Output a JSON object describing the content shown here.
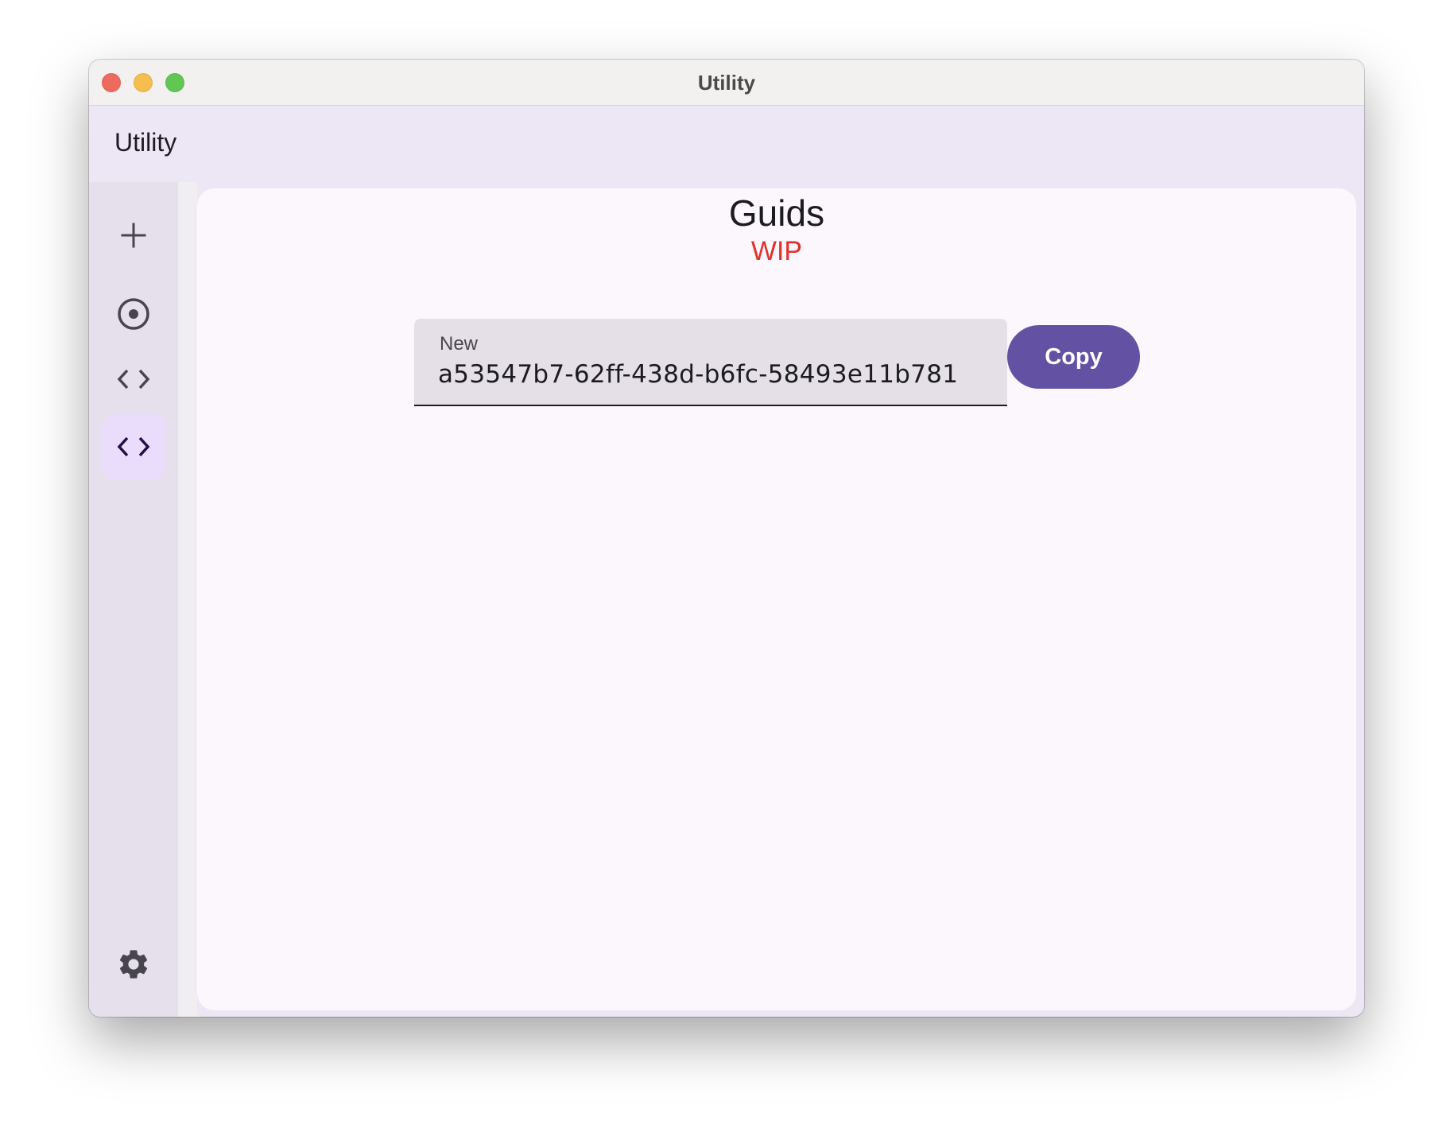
{
  "window": {
    "title": "Utility"
  },
  "appbar": {
    "title": "Utility"
  },
  "rail": {
    "items": [
      {
        "icon": "add-icon",
        "active": false
      },
      {
        "icon": "radio-button-icon",
        "active": false
      },
      {
        "icon": "code-icon",
        "active": false
      },
      {
        "icon": "code-icon",
        "active": true
      }
    ],
    "footer_icon": "gear-icon"
  },
  "main": {
    "title": "Guids",
    "subtitle": "WIP",
    "guid_field": {
      "label": "New",
      "value": "a53547b7-62ff-438d-b6fc-58493e11b781"
    },
    "copy_label": "Copy"
  },
  "colors": {
    "accent": "#6351a3",
    "wip": "#e0312a",
    "rail_active": "#e9ddfb",
    "surface": "#fcf7fd"
  }
}
